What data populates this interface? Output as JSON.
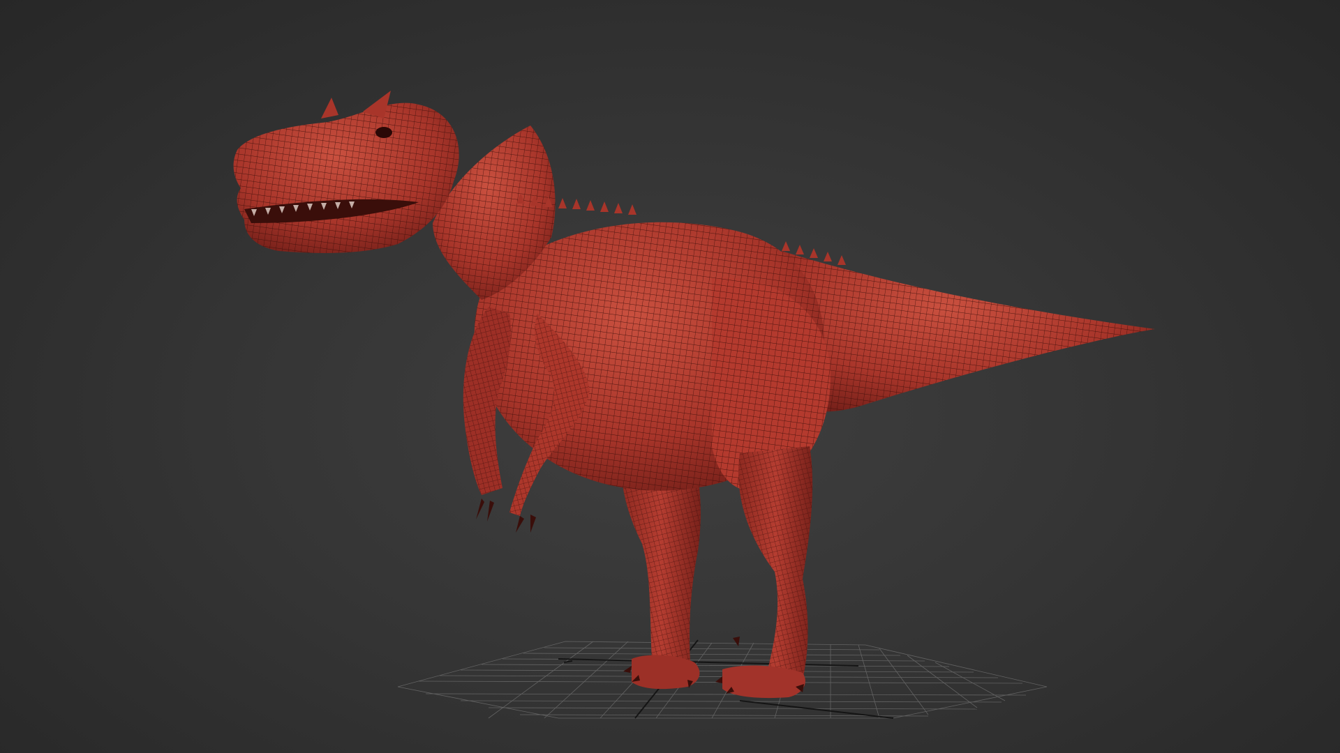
{
  "viewport": {
    "background_top": "#2a2a2a",
    "background_center": "#3f3f3f",
    "grid_color": "#8a8a8a",
    "grid_axis_color": "#101010"
  },
  "model": {
    "subject": "dinosaur-mesh",
    "base_color": "#b23a2f",
    "shadow_color": "#6e1d17",
    "highlight_color": "#cf5a4c",
    "wire_color": "#3a0d09"
  }
}
